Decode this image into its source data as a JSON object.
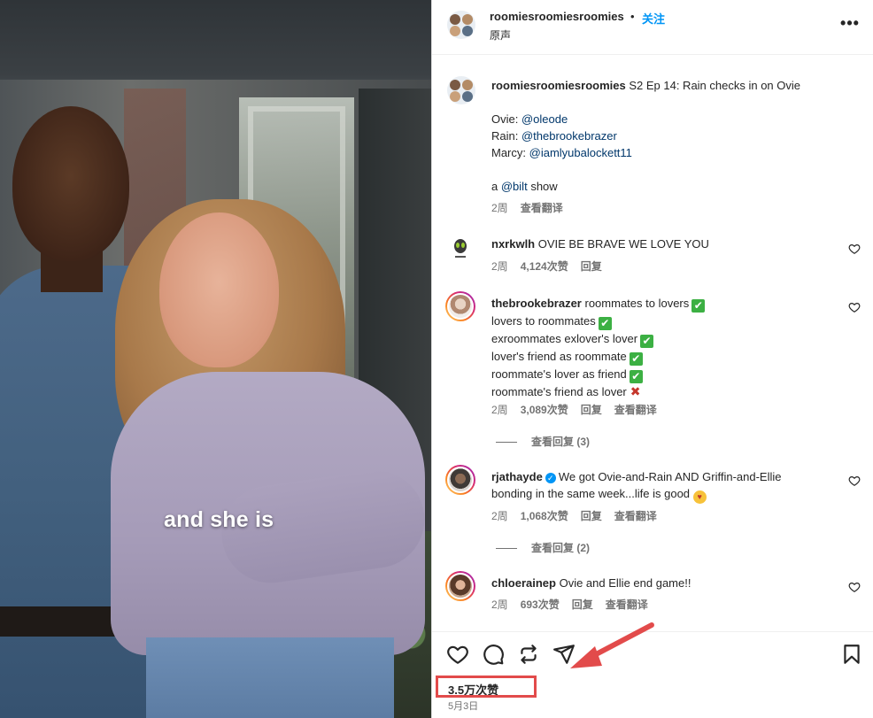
{
  "video": {
    "caption": "and she is"
  },
  "header": {
    "username": "roomiesroomiesroomies",
    "separator": "•",
    "follow_label": "关注",
    "audio_label": "原声",
    "more_label": "•••"
  },
  "post": {
    "username": "roomiesroomiesroomies",
    "title": "S2 Ep 14: Rain checks in on Ovie",
    "credits": [
      {
        "role": "Ovie:",
        "handle": "@oleode"
      },
      {
        "role": "Rain:",
        "handle": "@thebrookebrazer"
      },
      {
        "role": "Marcy:",
        "handle": "@iamlyubalockett11"
      }
    ],
    "show_prefix": "a",
    "show_handle": "@bilt",
    "show_suffix": "show",
    "time": "2周",
    "translate_label": "查看翻译"
  },
  "comments": [
    {
      "username": "nxrkwlh",
      "text": "OVIE BE BRAVE WE LOVE YOU",
      "time": "2周",
      "likes": "4,124次赞",
      "reply_label": "回复"
    },
    {
      "username": "thebrookebrazer",
      "lines": [
        "roommates to lovers",
        "lovers to roommates",
        "exroommates exlover's lover",
        "lover's friend as roommate",
        "roommate's lover as friend",
        "roommate's friend as lover"
      ],
      "time": "2周",
      "likes": "3,089次赞",
      "reply_label": "回复",
      "translate_label": "查看翻译",
      "view_replies": "查看回复 (3)"
    },
    {
      "username": "rjathayde",
      "line1": "We got Ovie-and-Rain AND Griffin-and-Ellie",
      "line2": "bonding in the same week...life is good",
      "time": "2周",
      "likes": "1,068次赞",
      "reply_label": "回复",
      "translate_label": "查看翻译",
      "view_replies": "查看回复 (2)"
    },
    {
      "username": "chloerainep",
      "text": "Ovie and Ellie end game!!",
      "time": "2周",
      "likes": "693次赞",
      "reply_label": "回复",
      "translate_label": "查看翻译"
    }
  ],
  "footer": {
    "likes": "3.5万次赞",
    "date": "5月3日"
  },
  "colors": {
    "follow": "#0095f6",
    "mention": "#00376b",
    "annotation": "#e24b4b"
  }
}
